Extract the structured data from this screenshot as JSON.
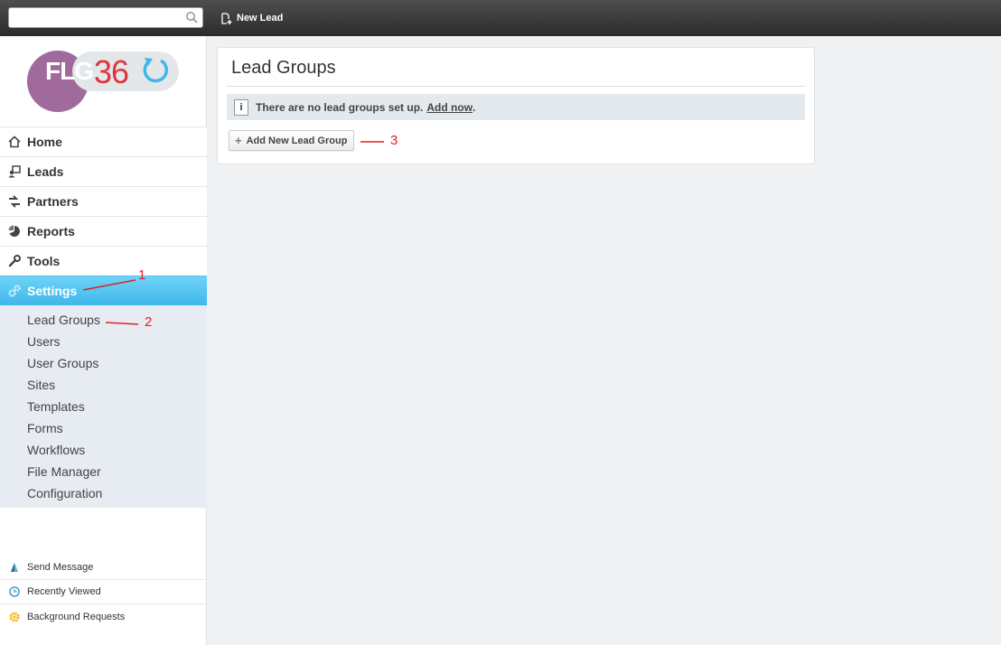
{
  "topbar": {
    "search": {
      "value": "",
      "placeholder": ""
    },
    "new_lead_label": "New Lead"
  },
  "logo": {
    "flg": "FLG",
    "num": "36"
  },
  "nav": {
    "items": [
      {
        "label": "Home",
        "icon": "home-icon"
      },
      {
        "label": "Leads",
        "icon": "leads-icon"
      },
      {
        "label": "Partners",
        "icon": "partners-icon"
      },
      {
        "label": "Reports",
        "icon": "reports-icon"
      },
      {
        "label": "Tools",
        "icon": "wrench-icon"
      },
      {
        "label": "Settings",
        "icon": "gears-icon",
        "active": true
      }
    ],
    "settings_sub": [
      "Lead Groups",
      "Users",
      "User Groups",
      "Sites",
      "Templates",
      "Forms",
      "Workflows",
      "File Manager",
      "Configuration"
    ]
  },
  "utility": [
    {
      "label": "Send Message",
      "icon": "send-message-icon"
    },
    {
      "label": "Recently Viewed",
      "icon": "clock-icon"
    },
    {
      "label": "Background Requests",
      "icon": "gear-icon"
    }
  ],
  "main": {
    "title": "Lead Groups",
    "notice_text": "There are no lead groups set up.",
    "notice_link": "Add now",
    "notice_end": ".",
    "info_icon_glyph": "i",
    "add_button_label": "Add New Lead Group",
    "add_button_icon": "+"
  },
  "annotations": [
    "1",
    "2",
    "3"
  ],
  "colors": {
    "active_nav": "#3fb7ea",
    "topbar": "#2b2b2b",
    "annotation": "#e02020",
    "logo_purple": "#a06a9c",
    "logo_red": "#e0353b",
    "logo_blue": "#3fb7ea"
  }
}
